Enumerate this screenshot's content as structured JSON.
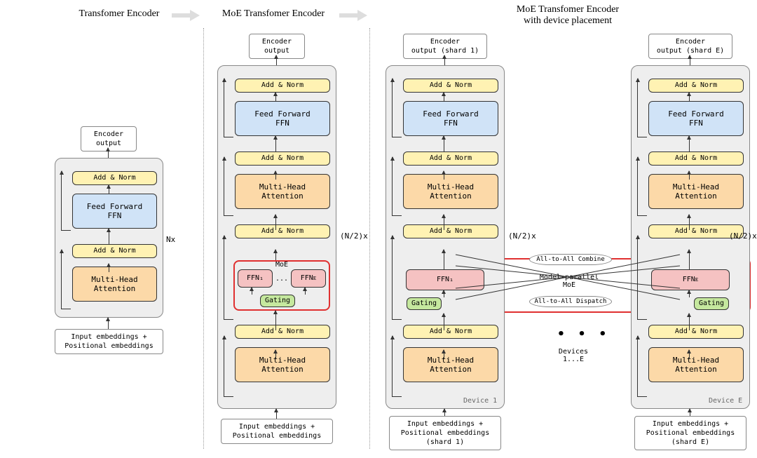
{
  "titles": {
    "t1": "Transfomer Encoder",
    "t2": "MoE Transfomer Encoder",
    "t3": "MoE Transfomer Encoder\nwith device placement"
  },
  "labels": {
    "addnorm": "Add & Norm",
    "ffn": "Feed Forward\nFFN",
    "mha": "Multi-Head\nAttention",
    "gating": "Gating",
    "moe": "MoE",
    "model_parallel_moe": "Model-parallel\nMoE",
    "ffn1": "FFN₁",
    "ffnE": "FFNᴇ",
    "ellipsis": "...",
    "encoder_output": "Encoder\noutput",
    "encoder_output_s1": "Encoder\noutput (shard 1)",
    "encoder_output_sE": "Encoder\noutput (shard E)",
    "input": "Input embeddings +\nPositional embeddings",
    "input_s1": "Input embeddings +\nPositional embeddings\n(shard 1)",
    "input_sE": "Input embeddings +\nPositional embeddings\n(shard E)",
    "nx": "Nx",
    "n2x": "(N/2)x",
    "a2a_combine": "All-to-All Combine",
    "a2a_dispatch": "All-to-All Dispatch",
    "device1": "Device 1",
    "deviceE": "Device E",
    "devices_1E": "Devices\n1...E"
  }
}
